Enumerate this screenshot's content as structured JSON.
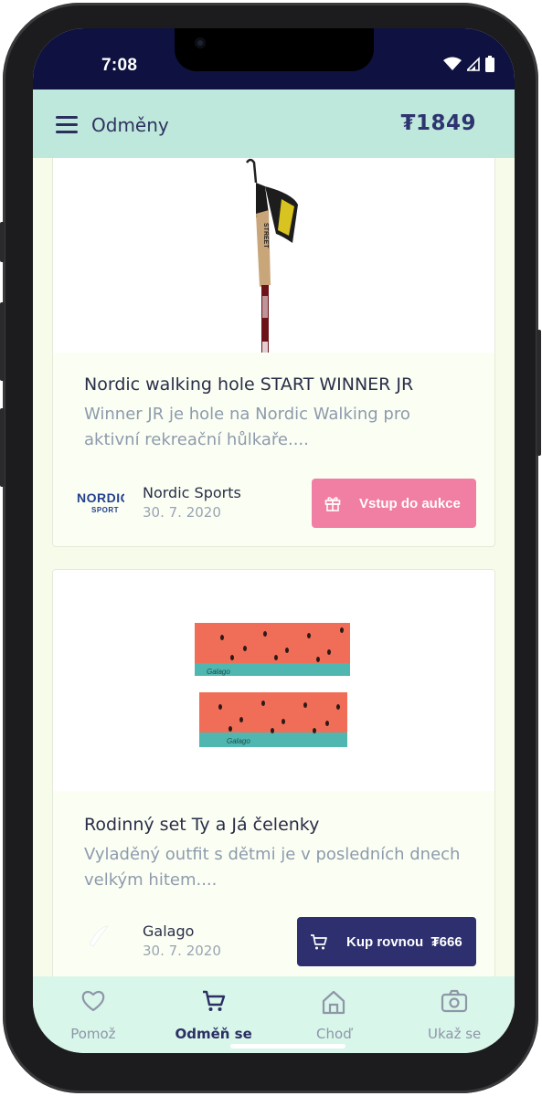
{
  "status_bar": {
    "time": "7:08"
  },
  "app_bar": {
    "title": "Odměny",
    "balance": "₮1849"
  },
  "rewards": [
    {
      "title": "Nordic walking hole START WINNER JR",
      "description": "Winner JR je hole na Nordic Walking pro aktivní rekreační hůlkaře....",
      "vendor": "Nordic Sports",
      "vendor_logo_text": "NORDIC SPORT",
      "date": "30. 7. 2020",
      "action_label": "Vstup do aukce",
      "action_icon": "gift-icon",
      "image_text": "STREET"
    },
    {
      "title": "Rodinný set Ty a Já čelenky",
      "description": "Vyladěný outfit s dětmi je v posledních dnech velkým hitem....",
      "vendor": "Galago",
      "date": "30. 7. 2020",
      "action_label": "Kup rovnou  ₮666",
      "action_icon": "cart-icon",
      "image_text": "Galago"
    }
  ],
  "bottom_nav": [
    {
      "label": "Pomož",
      "icon": "heart-icon",
      "active": false
    },
    {
      "label": "Odměň se",
      "icon": "cart-icon",
      "active": true
    },
    {
      "label": "Choď",
      "icon": "home-icon",
      "active": false
    },
    {
      "label": "Ukaž se",
      "icon": "camera-icon",
      "active": false
    }
  ],
  "colors": {
    "app_bar": "#bfe8dc",
    "status_bar": "#0f1240",
    "auction_button": "#f07fa3",
    "buy_button": "#2e2f6f",
    "bottom_nav": "#d9f6ea",
    "content_bg": "#f6fce9"
  }
}
